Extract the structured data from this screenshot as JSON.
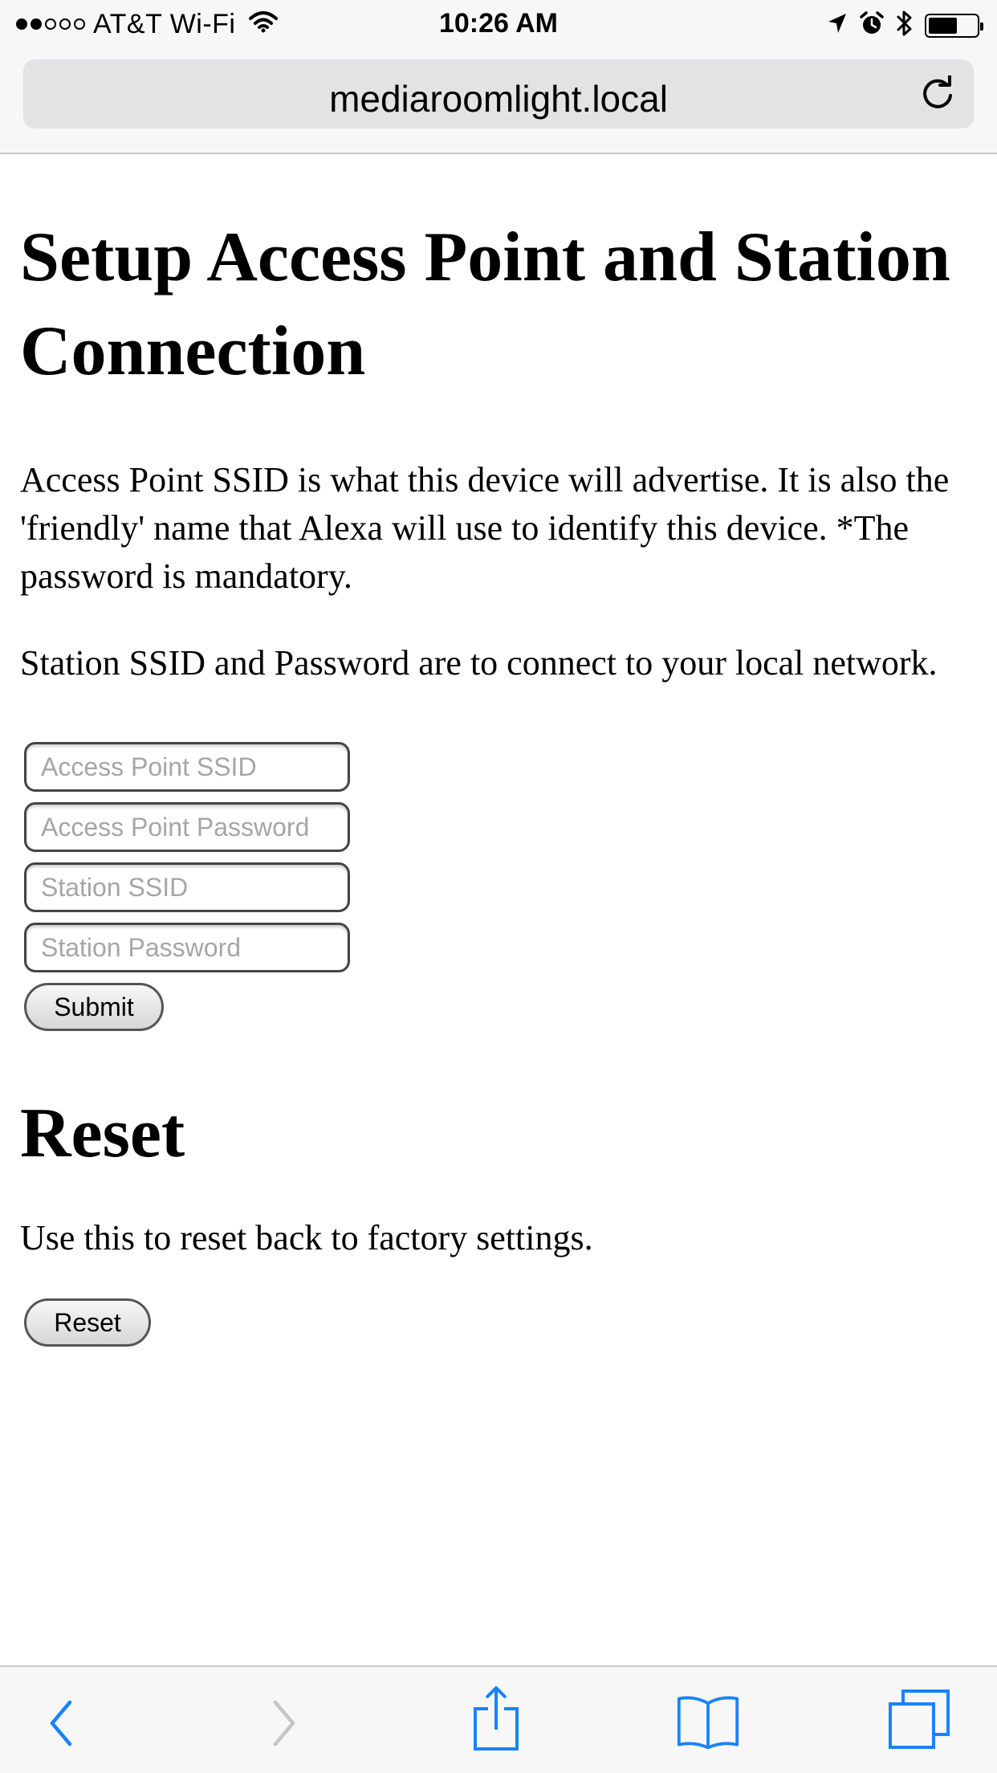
{
  "status_bar": {
    "carrier": "AT&T Wi-Fi",
    "time": "10:26 AM",
    "signal_filled": 2,
    "signal_total": 5,
    "battery_level": 0.6,
    "icons": [
      "wifi-icon",
      "location-arrow-icon",
      "alarm-icon",
      "bluetooth-icon",
      "battery-icon"
    ]
  },
  "address_bar": {
    "url": "mediaroomlight.local",
    "reload_icon": "reload-icon"
  },
  "main": {
    "title": "Setup Access Point and Station Connection",
    "intro_paragraph": "Access Point SSID is what this device will advertise. It is also the 'friendly' name that Alexa will use to identify this device. *The password is mandatory.",
    "station_paragraph": "Station SSID and Password are to connect to your local network.",
    "form": {
      "ap_ssid_placeholder": "Access Point SSID",
      "ap_password_placeholder": "Access Point Password",
      "station_ssid_placeholder": "Station SSID",
      "station_password_placeholder": "Station Password",
      "submit_label": "Submit"
    },
    "reset_section": {
      "title": "Reset",
      "description": "Use this to reset back to factory settings.",
      "button_label": "Reset"
    }
  },
  "bottom_toolbar": {
    "items": [
      "back-icon",
      "forward-icon",
      "share-icon",
      "bookmarks-icon",
      "tabs-icon"
    ],
    "accent_color": "#1a82fb",
    "disabled_color": "#c4c4c9"
  }
}
